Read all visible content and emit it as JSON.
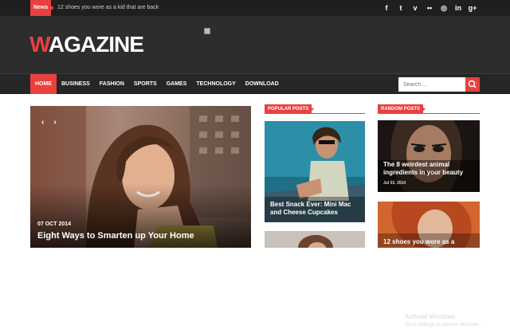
{
  "topbar": {
    "badge": "News",
    "ticker": "12 shoes you wore as a kid that are back",
    "social_icons": [
      "facebook-icon",
      "twitter-icon",
      "vimeo-icon",
      "flickr-icon",
      "dribbble-icon",
      "linkedin-icon",
      "googleplus-icon"
    ],
    "social_glyphs": [
      "f",
      "t",
      "v",
      "••",
      "◎",
      "in",
      "g+"
    ]
  },
  "header": {
    "logo_initial": "W",
    "logo_rest": "AGAZINE"
  },
  "nav": {
    "items": [
      "HOME",
      "BUSINESS",
      "FASHION",
      "SPORTS",
      "GAMES",
      "TECHNOLOGY",
      "DOWNLOAD"
    ],
    "active_index": 0,
    "search_placeholder": "Search ..."
  },
  "feature": {
    "prev": "‹",
    "next": "›",
    "date": "07  OCT  2014",
    "title": "Eight Ways to Smarten up Your Home"
  },
  "popular": {
    "heading": "POPULAR POSTS",
    "posts": [
      {
        "title_line1": "Best Snack Ever: Mini Mac",
        "title_line2": "and Cheese Cupcakes"
      }
    ]
  },
  "random": {
    "heading": "RANDOM POSTS",
    "posts": [
      {
        "title_line1": "The 8 weirdest animal",
        "title_line2": "ingredients in your beauty",
        "date": "Jul 03, 2014"
      },
      {
        "title_line1": "12 shoes you wore as a"
      }
    ]
  },
  "watermark": {
    "line1": "Activate Windows",
    "line2": "Go to Settings to activate Windows."
  },
  "colors": {
    "accent": "#e8403f",
    "topbar": "#1f1f1f",
    "header": "#2d2d2d",
    "nav": "#262626"
  }
}
